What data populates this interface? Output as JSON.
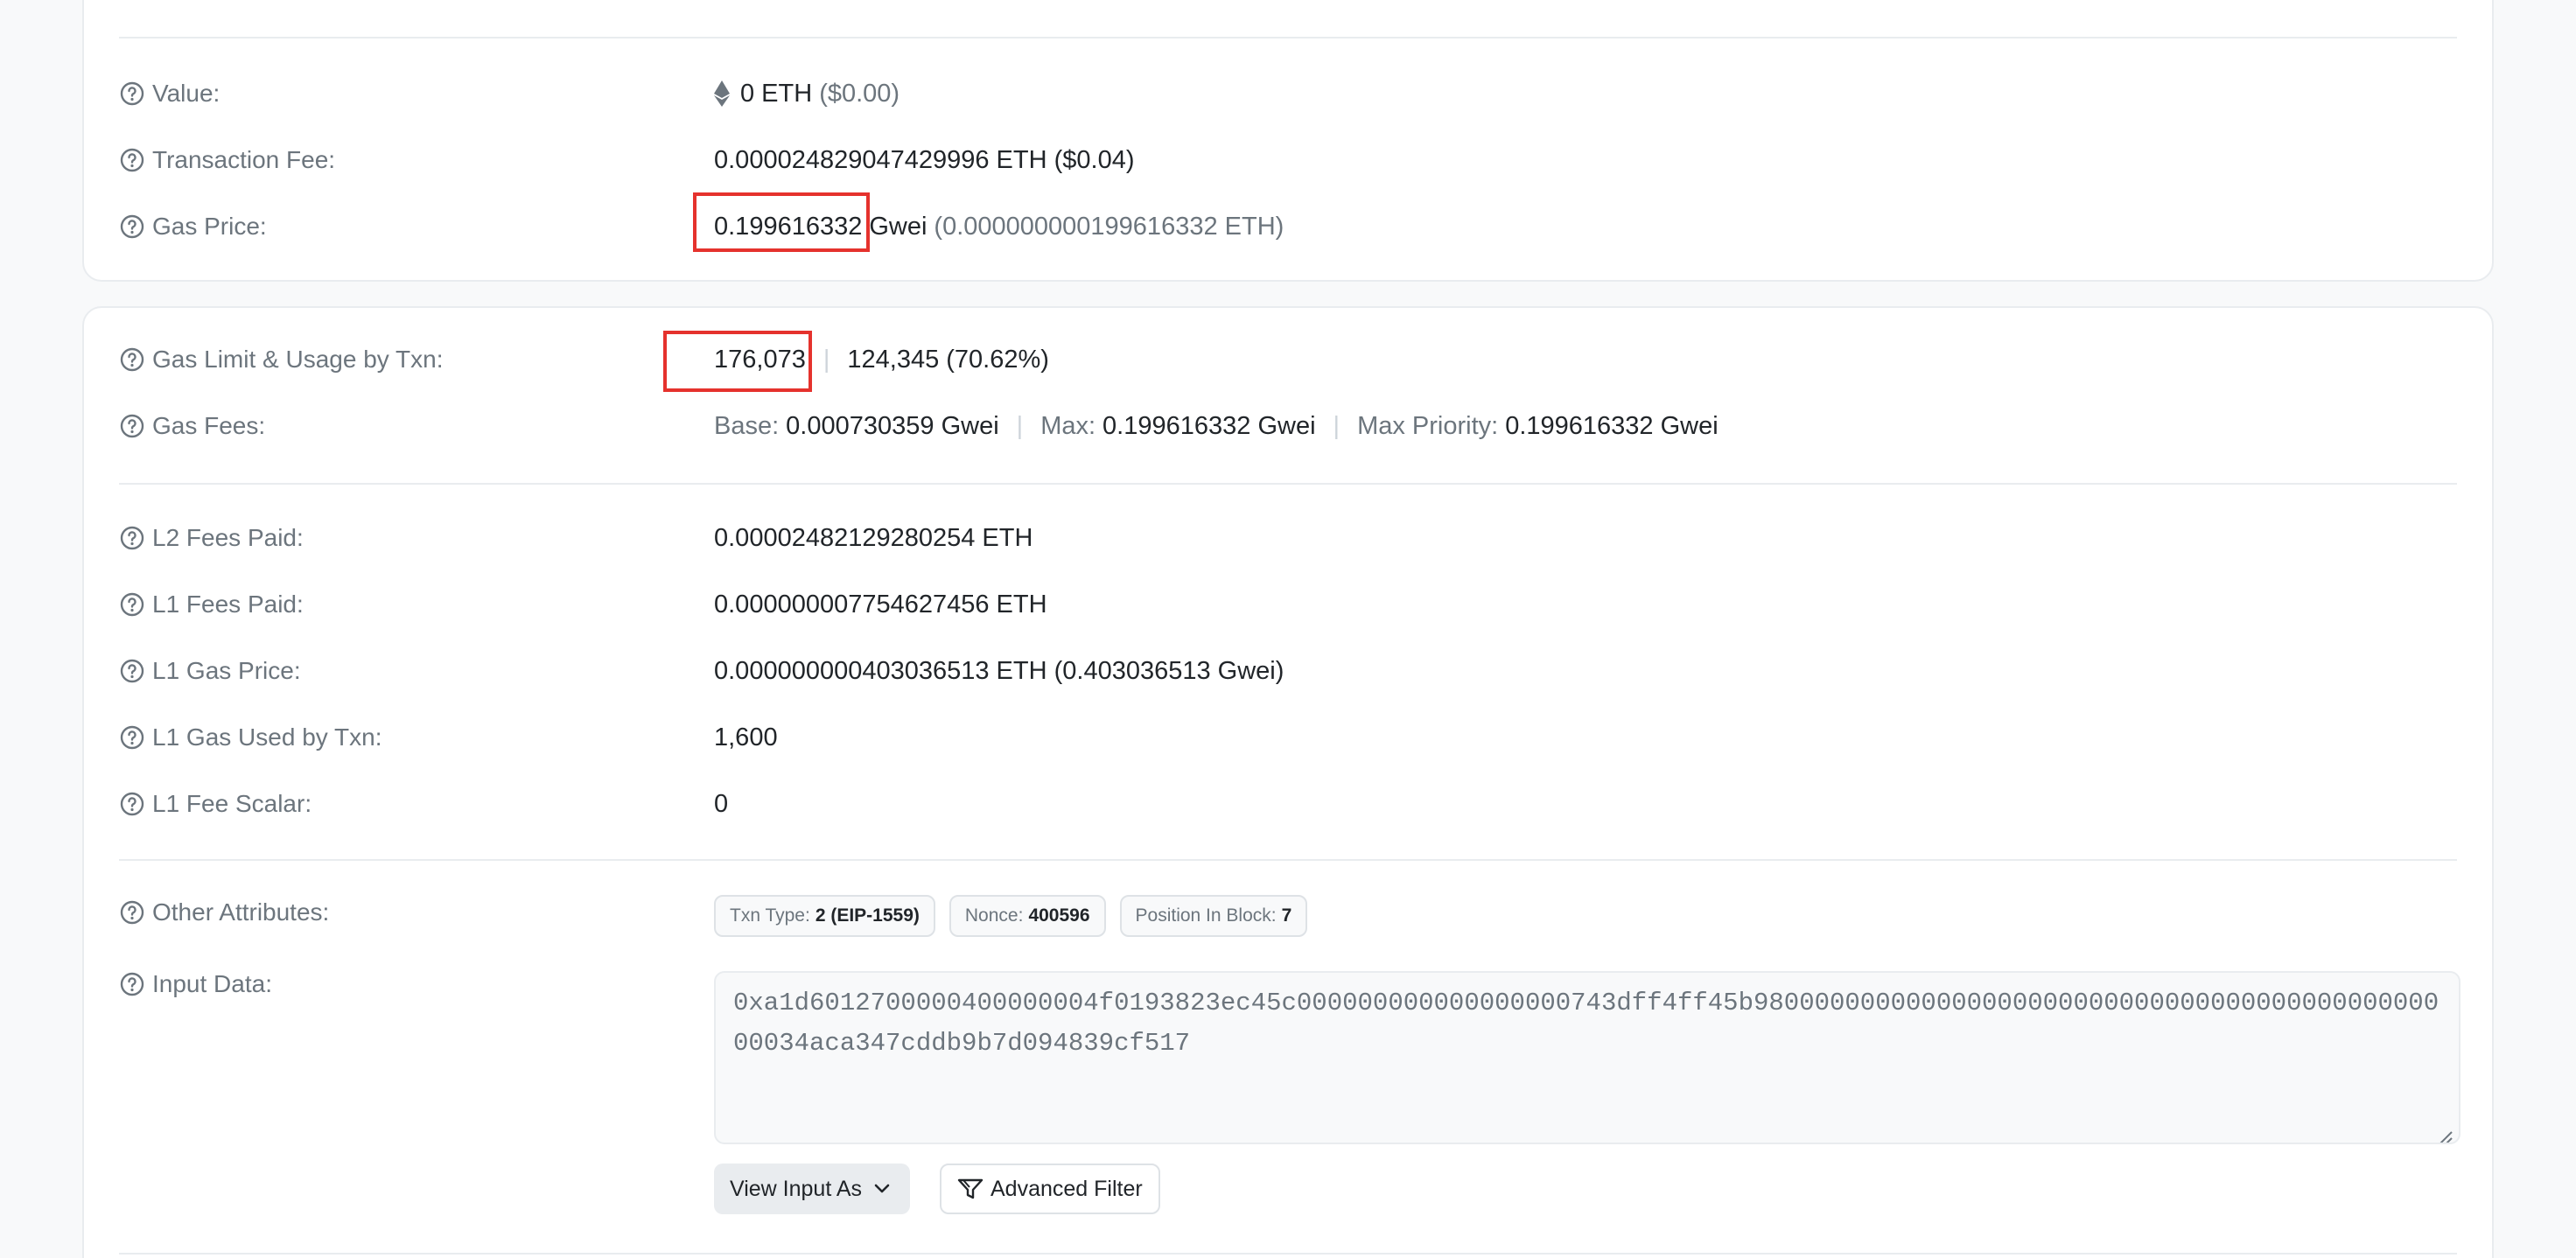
{
  "overview": {
    "value": {
      "label": "Value:",
      "amount": "0 ETH",
      "usd": "($0.00)"
    },
    "transaction_fee": {
      "label": "Transaction Fee:",
      "value": "0.000024829047429996 ETH ($0.04)"
    },
    "gas_price": {
      "label": "Gas Price:",
      "gwei": "0.199616332",
      "unit": "Gwei",
      "eth": "(0.000000000199616332 ETH)"
    }
  },
  "gas": {
    "limit_usage": {
      "label": "Gas Limit & Usage by Txn:",
      "limit": "176,073",
      "sep": "|",
      "usage": "124,345 (70.62%)"
    },
    "fees": {
      "label": "Gas Fees:",
      "base_label": "Base:",
      "base_value": "0.000730359 Gwei",
      "sep": "|",
      "max_label": "Max:",
      "max_value": "0.199616332 Gwei",
      "priority_label": "Max Priority:",
      "priority_value": "0.199616332 Gwei"
    },
    "l2_fees_paid": {
      "label": "L2 Fees Paid:",
      "value": "0.00002482129280254 ETH"
    },
    "l1_fees_paid": {
      "label": "L1 Fees Paid:",
      "value": "0.000000007754627456 ETH"
    },
    "l1_gas_price": {
      "label": "L1 Gas Price:",
      "value": "0.000000000403036513 ETH (0.403036513 Gwei)"
    },
    "l1_gas_used": {
      "label": "L1 Gas Used by Txn:",
      "value": "1,600"
    },
    "l1_fee_scalar": {
      "label": "L1 Fee Scalar:",
      "value": "0"
    },
    "other_attributes": {
      "label": "Other Attributes:",
      "txn_type_label": "Txn Type:",
      "txn_type_value": "2 (EIP-1559)",
      "nonce_label": "Nonce:",
      "nonce_value": "400596",
      "position_label": "Position In Block:",
      "position_value": "7"
    },
    "input_data": {
      "label": "Input Data:",
      "value": "0xa1d6012700000400000004f0193823ec45c000000000000000000743dff4ff45b98000000000000000000000000000000000000000000000034aca347cddb9b7d094839cf517",
      "view_as_label": "View Input As",
      "advanced_filter_label": "Advanced Filter"
    }
  },
  "colors": {
    "highlight": "#e5322d",
    "muted_text": "#6c757d",
    "border": "#e9ecef"
  },
  "icons": [
    "help-circle-icon",
    "ethereum-icon",
    "chevron-down-icon",
    "filter-icon"
  ]
}
